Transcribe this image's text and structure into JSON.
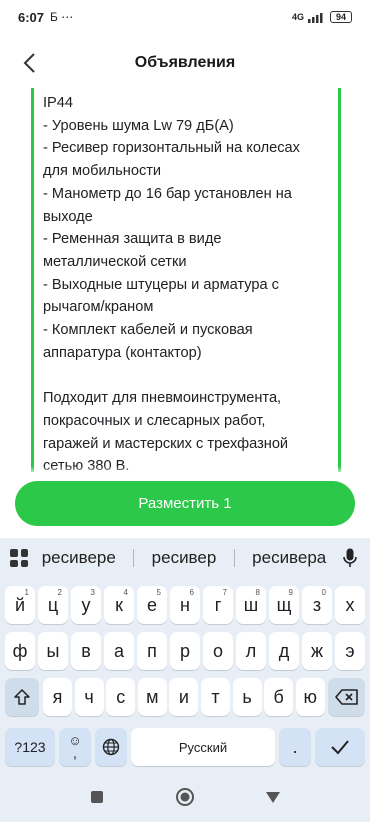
{
  "status_bar": {
    "time": "6:07",
    "indicators": "Б ⋯",
    "network": "4G",
    "battery": "94"
  },
  "header": {
    "title": "Объявления",
    "back_icon": "chevron-left-icon"
  },
  "content": {
    "text": "IP44\n  - Уровень шума Lw 79 дБ(А)\n- Ресивер горизонтальный на колесах\nдля мобильности\n- Манометр до 16 бар установлен на\nвыходе\n- Ременная защита в виде\nметаллической сетки\n- Выходные штуцеры и арматура с\nрычагом/краном\n- Комплект кабелей и пусковая\nаппаратура (контактор)\n\nПодходит для пневмоинструмента,\nпокрасочных и слесарных работ,\nгаражей и мастерских с трехфазной\nсетью 380 В.",
    "accent_color": "#2cc84a"
  },
  "submit": {
    "label": "Разместить 1",
    "color": "#2cc84a"
  },
  "keyboard": {
    "suggestions": [
      "ресивере",
      "ресивер",
      "ресивера"
    ],
    "row1": [
      {
        "key": "й",
        "hint": "1"
      },
      {
        "key": "ц",
        "hint": "2"
      },
      {
        "key": "у",
        "hint": "3"
      },
      {
        "key": "к",
        "hint": "4"
      },
      {
        "key": "е",
        "hint": "5"
      },
      {
        "key": "н",
        "hint": "6"
      },
      {
        "key": "г",
        "hint": "7"
      },
      {
        "key": "ш",
        "hint": "8"
      },
      {
        "key": "щ",
        "hint": "9"
      },
      {
        "key": "з",
        "hint": "0"
      },
      {
        "key": "х",
        "hint": ""
      }
    ],
    "row2": [
      "ф",
      "ы",
      "в",
      "а",
      "п",
      "р",
      "о",
      "л",
      "д",
      "ж",
      "э"
    ],
    "row3": [
      "я",
      "ч",
      "с",
      "м",
      "и",
      "т",
      "ь",
      "б",
      "ю"
    ],
    "symbols_label": "?123",
    "emoji_label": "☺",
    "comma_label": ",",
    "space_label": "Русский",
    "period_label": "."
  }
}
